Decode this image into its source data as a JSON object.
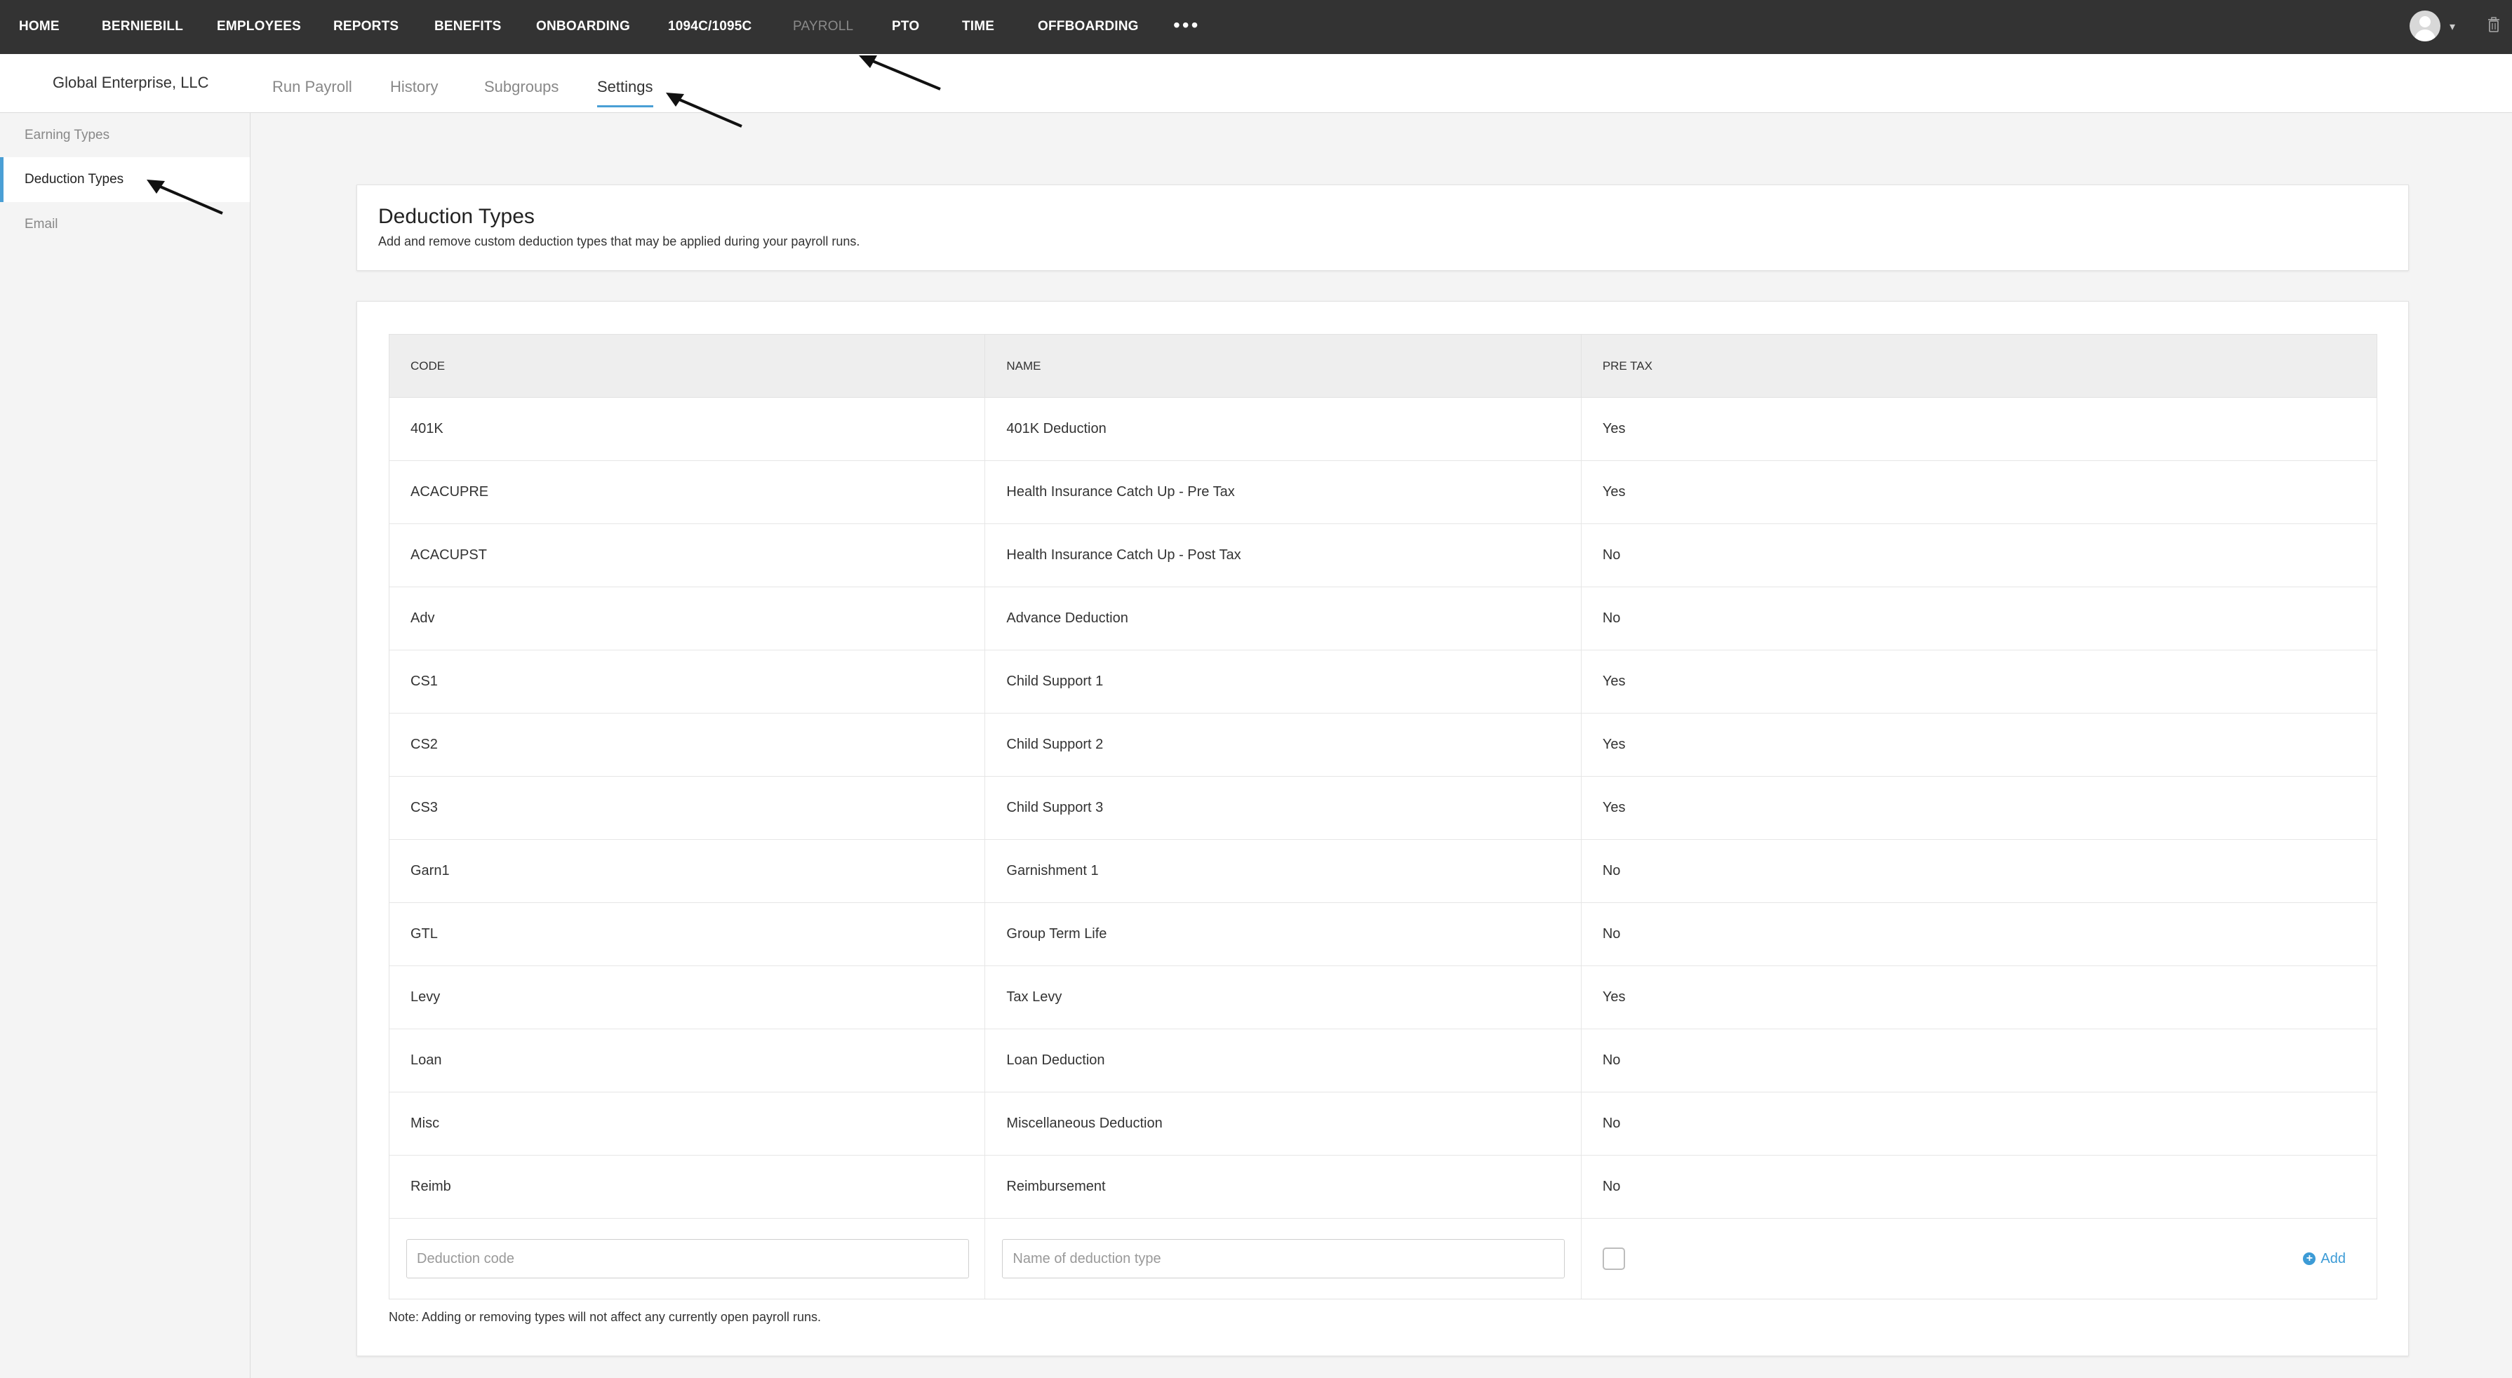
{
  "topnav": {
    "items": [
      "HOME",
      "BERNIEBILL",
      "EMPLOYEES",
      "REPORTS",
      "BENEFITS",
      "ONBOARDING",
      "1094C/1095C",
      "PAYROLL",
      "PTO",
      "TIME",
      "OFFBOARDING"
    ],
    "active": "PAYROLL",
    "more_label": "•••"
  },
  "subheader": {
    "company": "Global Enterprise, LLC",
    "tabs": [
      "Run Payroll",
      "History",
      "Subgroups",
      "Settings"
    ],
    "active_tab": "Settings"
  },
  "sidebar": {
    "items": [
      "Earning Types",
      "Deduction Types",
      "Email"
    ],
    "active": "Deduction Types"
  },
  "header": {
    "title": "Deduction Types",
    "description": "Add and remove custom deduction types that may be applied during your payroll runs."
  },
  "table": {
    "columns": [
      "CODE",
      "NAME",
      "PRE TAX"
    ],
    "rows": [
      [
        "401K",
        "401K Deduction",
        "Yes"
      ],
      [
        "ACACUPRE",
        "Health Insurance Catch Up - Pre Tax",
        "Yes"
      ],
      [
        "ACACUPST",
        "Health Insurance Catch Up - Post Tax",
        "No"
      ],
      [
        "Adv",
        "Advance Deduction",
        "No"
      ],
      [
        "CS1",
        "Child Support 1",
        "Yes"
      ],
      [
        "CS2",
        "Child Support 2",
        "Yes"
      ],
      [
        "CS3",
        "Child Support 3",
        "Yes"
      ],
      [
        "Garn1",
        "Garnishment 1",
        "No"
      ],
      [
        "GTL",
        "Group Term Life",
        "No"
      ],
      [
        "Levy",
        "Tax Levy",
        "Yes"
      ],
      [
        "Loan",
        "Loan Deduction",
        "No"
      ],
      [
        "Misc",
        "Miscellaneous Deduction",
        "No"
      ],
      [
        "Reimb",
        "Reimbursement",
        "No"
      ]
    ],
    "add_row": {
      "code_placeholder": "Deduction code",
      "name_placeholder": "Name of deduction type",
      "add_label": "Add"
    },
    "note": "Note: Adding or removing types will not affect any currently open payroll runs."
  },
  "colors": {
    "topbar": "#333333",
    "accent": "#4a9fd5",
    "link": "#3c9bd6"
  }
}
